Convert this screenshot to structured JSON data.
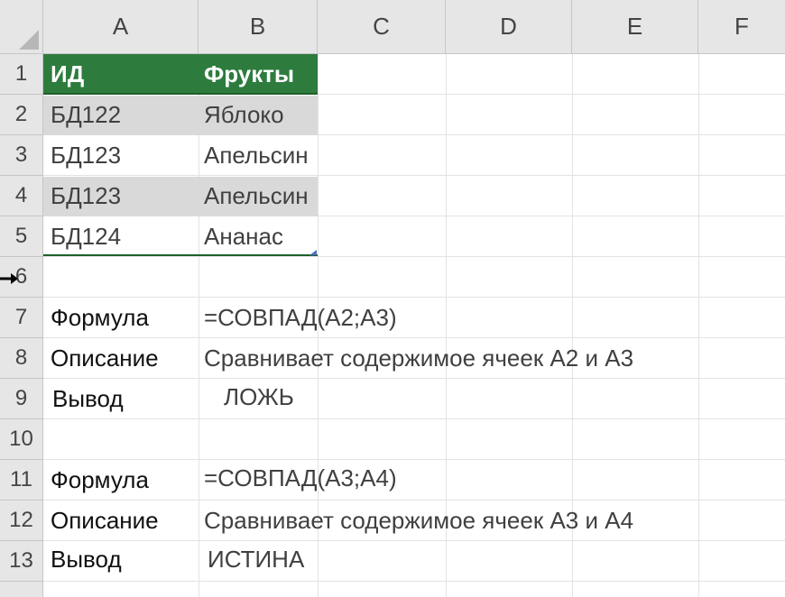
{
  "columns": [
    "A",
    "B",
    "C",
    "D",
    "E",
    "F"
  ],
  "rows": [
    "1",
    "2",
    "3",
    "4",
    "5",
    "6",
    "7",
    "8",
    "9",
    "10",
    "11",
    "12",
    "13"
  ],
  "table": {
    "header": {
      "id": "ИД",
      "fruit": "Фрукты"
    },
    "rows": [
      {
        "id": "БД122",
        "fruit": "Яблоко"
      },
      {
        "id": "БД123",
        "fruit": "Апельсин"
      },
      {
        "id": "БД123",
        "fruit": "Апельсин"
      },
      {
        "id": "БД124",
        "fruit": "Ананас"
      }
    ],
    "header_color": "#2d7c3e",
    "band_color": "#d9d9d9"
  },
  "example1": {
    "formula_label": "Формула",
    "formula": "=СОВПАД(A2;A3)",
    "description_label": "Описание",
    "description": "Сравнивает содержимое ячеек A2 и A3",
    "output_label": "Вывод",
    "output": "ЛОЖЬ"
  },
  "example2": {
    "formula_label": "Формула",
    "formula": "=СОВПАД(A3;A4)",
    "description_label": "Описание",
    "description": "Сравнивает содержимое ячеек A3 и A4",
    "output_label": "Вывод",
    "output": "ИСТИНА"
  },
  "cursor_icon": "resize-row-cursor-icon"
}
